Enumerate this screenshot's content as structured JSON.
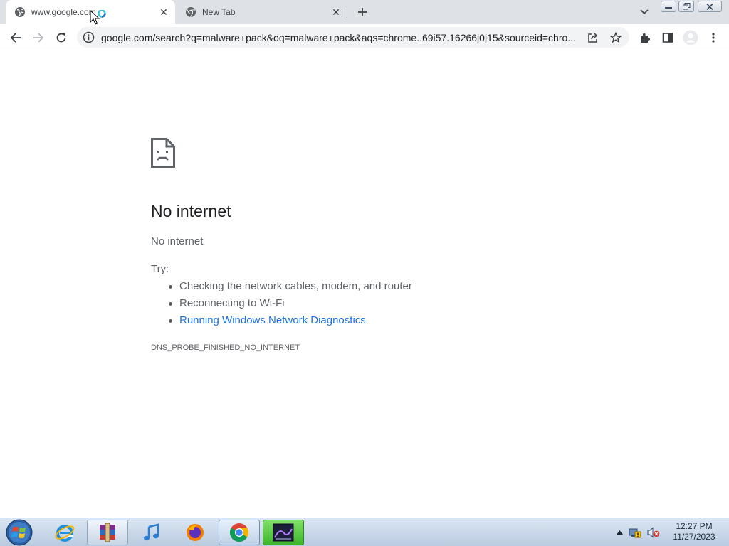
{
  "browser": {
    "tabs": [
      {
        "label": "www.google.com",
        "active": true
      },
      {
        "label": "New Tab",
        "active": false
      }
    ],
    "url": "google.com/search?q=malware+pack&oq=malware+pack&aqs=chrome..69i57.16266j0j15&sourceid=chro..."
  },
  "error_page": {
    "heading": "No internet",
    "subheading": "No internet",
    "try_label": "Try:",
    "suggestions": [
      "Checking the network cables, modem, and router",
      "Reconnecting to Wi-Fi"
    ],
    "diagnostics_link": "Running Windows Network Diagnostics",
    "error_code": "DNS_PROBE_FINISHED_NO_INTERNET"
  },
  "taskbar": {
    "apps": [
      "start-orb",
      "internet-explorer",
      "winrar",
      "itunes",
      "firefox",
      "chrome",
      "media-app"
    ],
    "clock_time": "12:27 PM",
    "clock_date": "11/27/2023"
  },
  "colors": {
    "tabstrip": "#dee1e6",
    "omnibox": "#f1f3f4",
    "link": "#1a73e8",
    "body_text": "#5f6368",
    "heading": "#202124"
  }
}
